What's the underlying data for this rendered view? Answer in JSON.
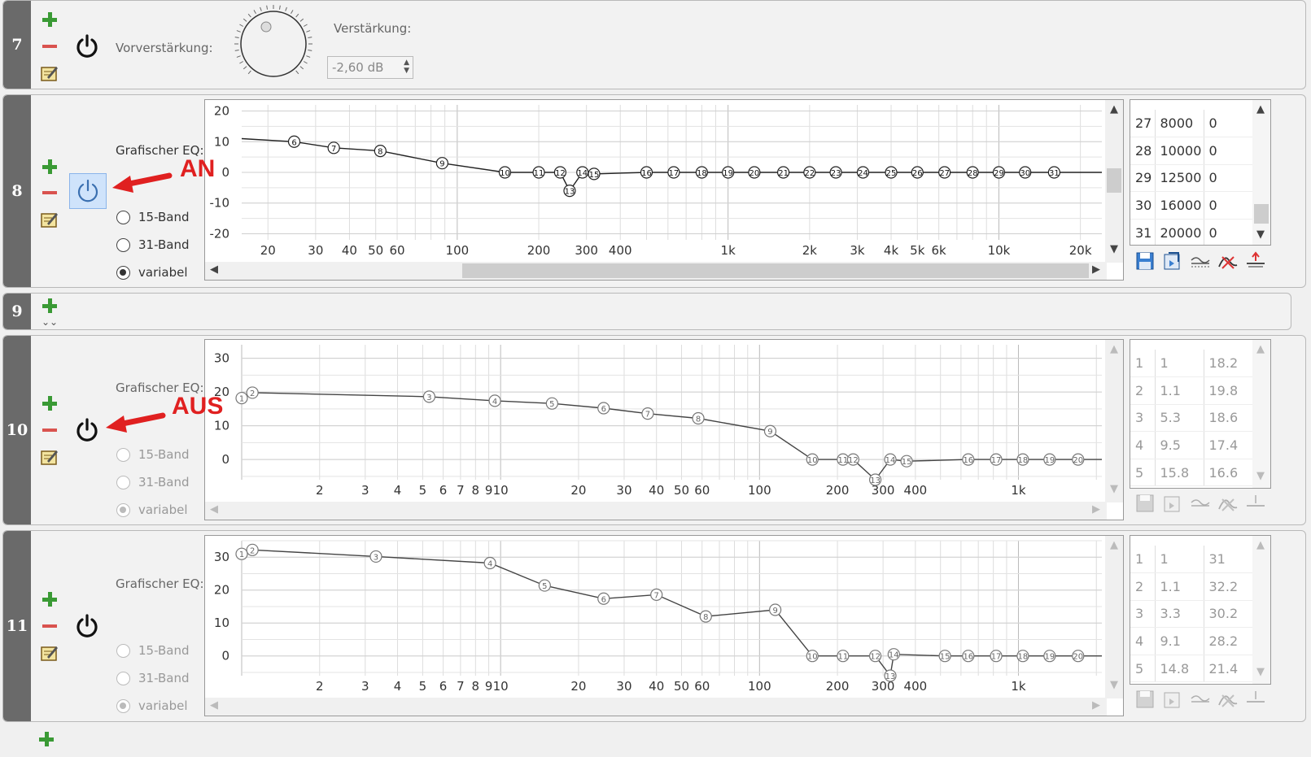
{
  "rows": {
    "r7": {
      "num": "7",
      "preamp_label": "Vorverstärkung:",
      "gain_label": "Verstärkung:",
      "gain_value": "-2,60 dB"
    },
    "r8": {
      "num": "8",
      "eq_label": "Grafischer EQ:",
      "radio_15": "15-Band",
      "radio_31": "31-Band",
      "radio_var": "variabel",
      "selected": "variabel",
      "power_state": "on"
    },
    "r9": {
      "num": "9"
    },
    "r10": {
      "num": "10",
      "eq_label": "Grafischer EQ:",
      "radio_15": "15-Band",
      "radio_31": "31-Band",
      "radio_var": "variabel",
      "selected": "variabel",
      "power_state": "off"
    },
    "r11": {
      "num": "11",
      "eq_label": "Grafischer EQ:",
      "radio_15": "15-Band",
      "radio_31": "31-Band",
      "radio_var": "variabel",
      "selected": "variabel",
      "power_state": "off"
    }
  },
  "annotations": {
    "on": "AN",
    "off": "AUS"
  },
  "tables": {
    "t8": [
      [
        "27",
        "8000",
        "0"
      ],
      [
        "28",
        "10000",
        "0"
      ],
      [
        "29",
        "12500",
        "0"
      ],
      [
        "30",
        "16000",
        "0"
      ],
      [
        "31",
        "20000",
        "0"
      ]
    ],
    "t10": [
      [
        "1",
        "1",
        "18.2"
      ],
      [
        "2",
        "1.1",
        "19.8"
      ],
      [
        "3",
        "5.3",
        "18.6"
      ],
      [
        "4",
        "9.5",
        "17.4"
      ],
      [
        "5",
        "15.8",
        "16.6"
      ]
    ],
    "t11": [
      [
        "1",
        "1",
        "31"
      ],
      [
        "2",
        "1.1",
        "32.2"
      ],
      [
        "3",
        "3.3",
        "30.2"
      ],
      [
        "4",
        "9.1",
        "28.2"
      ],
      [
        "5",
        "14.8",
        "21.4"
      ]
    ]
  },
  "chart_data": [
    {
      "type": "line",
      "id": "eq8",
      "xscale": "log",
      "xlim": [
        16,
        24000
      ],
      "ylim": [
        -22,
        22
      ],
      "yticks": [
        20,
        10,
        0,
        -10,
        -20
      ],
      "ytick_labels": [
        "20",
        "10",
        "0",
        "-10",
        "-20"
      ],
      "xticks": [
        20,
        30,
        40,
        50,
        60,
        100,
        200,
        300,
        400,
        1000,
        2000,
        3000,
        4000,
        5000,
        6000,
        10000,
        20000
      ],
      "xtick_labels": [
        "20",
        "30",
        "40",
        "50",
        "60",
        "100",
        "200",
        "300",
        "400",
        "1k",
        "2k",
        "3k",
        "4k",
        "5k",
        "6k",
        "10k",
        "20k"
      ],
      "points": {
        "labels": [
          "",
          "6",
          "7",
          "8",
          "9",
          "10",
          "11",
          "12",
          "13",
          "14",
          "15",
          "16",
          "17",
          "18",
          "19",
          "20",
          "21",
          "22",
          "23",
          "24",
          "25",
          "26",
          "27",
          "28",
          "29",
          "30",
          "31"
        ],
        "x": [
          16,
          25,
          35,
          52,
          88,
          150,
          200,
          240,
          260,
          290,
          320,
          500,
          630,
          800,
          1000,
          1250,
          1600,
          2000,
          2500,
          3150,
          4000,
          5000,
          6300,
          8000,
          10000,
          12500,
          16000,
          20000
        ],
        "y": [
          11,
          10,
          8,
          7,
          3,
          0,
          0,
          0,
          -6,
          0,
          -0.5,
          0,
          0,
          0,
          0,
          0,
          0,
          0,
          0,
          0,
          0,
          0,
          0,
          0,
          0,
          0,
          0,
          0
        ]
      },
      "disabled": false
    },
    {
      "type": "line",
      "id": "eq10",
      "xscale": "log",
      "xlim": [
        1,
        2100
      ],
      "ylim": [
        -6,
        34
      ],
      "yticks": [
        30,
        20,
        10,
        0
      ],
      "ytick_labels": [
        "30",
        "20",
        "10",
        "0"
      ],
      "xticks": [
        2,
        3,
        4,
        5,
        6,
        7,
        8,
        9,
        10,
        20,
        30,
        40,
        50,
        60,
        100,
        200,
        300,
        400,
        1000
      ],
      "xtick_labels": [
        "2",
        "3",
        "4",
        "5",
        "6",
        "7",
        "8",
        "9",
        "10",
        "20",
        "30",
        "40",
        "50",
        "60",
        "100",
        "200",
        "300",
        "400",
        "1k"
      ],
      "points": {
        "labels": [
          "1",
          "2",
          "3",
          "4",
          "5",
          "6",
          "7",
          "8",
          "9",
          "10",
          "11",
          "12",
          "13",
          "14",
          "15",
          "16",
          "17",
          "18",
          "19",
          "20"
        ],
        "x": [
          1,
          1.1,
          5.3,
          9.5,
          15.8,
          25,
          37,
          58,
          110,
          160,
          210,
          230,
          280,
          320,
          370,
          640,
          820,
          1040,
          1320,
          1700
        ],
        "y": [
          18.2,
          19.8,
          18.6,
          17.4,
          16.6,
          15.2,
          13.6,
          12.2,
          8.4,
          0,
          0,
          0,
          -6,
          0,
          -0.5,
          0,
          0,
          0,
          0,
          0
        ]
      },
      "disabled": true
    },
    {
      "type": "line",
      "id": "eq11",
      "xscale": "log",
      "xlim": [
        1,
        2100
      ],
      "ylim": [
        -6,
        35
      ],
      "yticks": [
        30,
        20,
        10,
        0
      ],
      "ytick_labels": [
        "30",
        "20",
        "10",
        "0"
      ],
      "xticks": [
        2,
        3,
        4,
        5,
        6,
        7,
        8,
        9,
        10,
        20,
        30,
        40,
        50,
        60,
        100,
        200,
        300,
        400,
        1000
      ],
      "xtick_labels": [
        "2",
        "3",
        "4",
        "5",
        "6",
        "7",
        "8",
        "9",
        "10",
        "20",
        "30",
        "40",
        "50",
        "60",
        "100",
        "200",
        "300",
        "400",
        "1k"
      ],
      "points": {
        "labels": [
          "1",
          "2",
          "3",
          "4",
          "5",
          "6",
          "7",
          "8",
          "9",
          "10",
          "11",
          "12",
          "13",
          "14",
          "15",
          "16",
          "17",
          "18",
          "19",
          "20"
        ],
        "x": [
          1,
          1.1,
          3.3,
          9.1,
          14.8,
          25,
          40,
          62,
          115,
          160,
          210,
          280,
          320,
          330,
          520,
          640,
          820,
          1040,
          1320,
          1700
        ],
        "y": [
          31,
          32.2,
          30.2,
          28.2,
          21.4,
          17.4,
          18.6,
          12,
          14,
          0,
          0,
          0,
          -6,
          0.5,
          0,
          0,
          0,
          0,
          0,
          0
        ]
      },
      "disabled": true
    }
  ]
}
